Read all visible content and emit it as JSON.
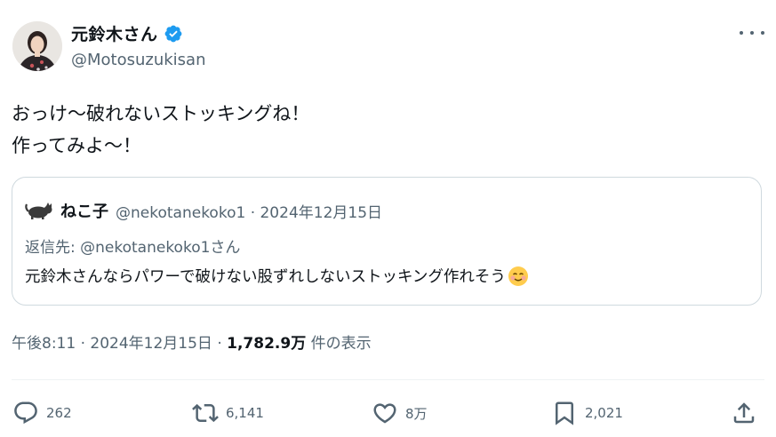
{
  "author": {
    "display_name": "元鈴木さん",
    "handle": "@Motosuzukisan",
    "verified_icon": "verified-badge-icon",
    "avatar_icon": "avatar"
  },
  "tweet": {
    "text": "おっけ〜破れないストッキングね！\n作ってみよ〜！"
  },
  "quote": {
    "name": "ねこ子",
    "meta": "@nekotanekoko1 · 2024年12月15日",
    "reply_label": "返信先: @nekotanekoko1さん",
    "text": "元鈴木さんならパワーで破けない股ずれしないストッキング作れそう",
    "emoji_icon": "smiling-face-icon"
  },
  "meta": {
    "time_date": "午後8:11 · 2024年12月15日 · ",
    "views": "1,782.9万",
    "views_label": " 件の表示"
  },
  "actions": {
    "reply_count": "262",
    "retweet_count": "6,141",
    "like_count": "8万",
    "bookmark_count": "2,021"
  },
  "colors": {
    "text": "#0f1419",
    "secondary": "#536471",
    "verified": "#1d9bf0",
    "border": "#cfd9de"
  }
}
